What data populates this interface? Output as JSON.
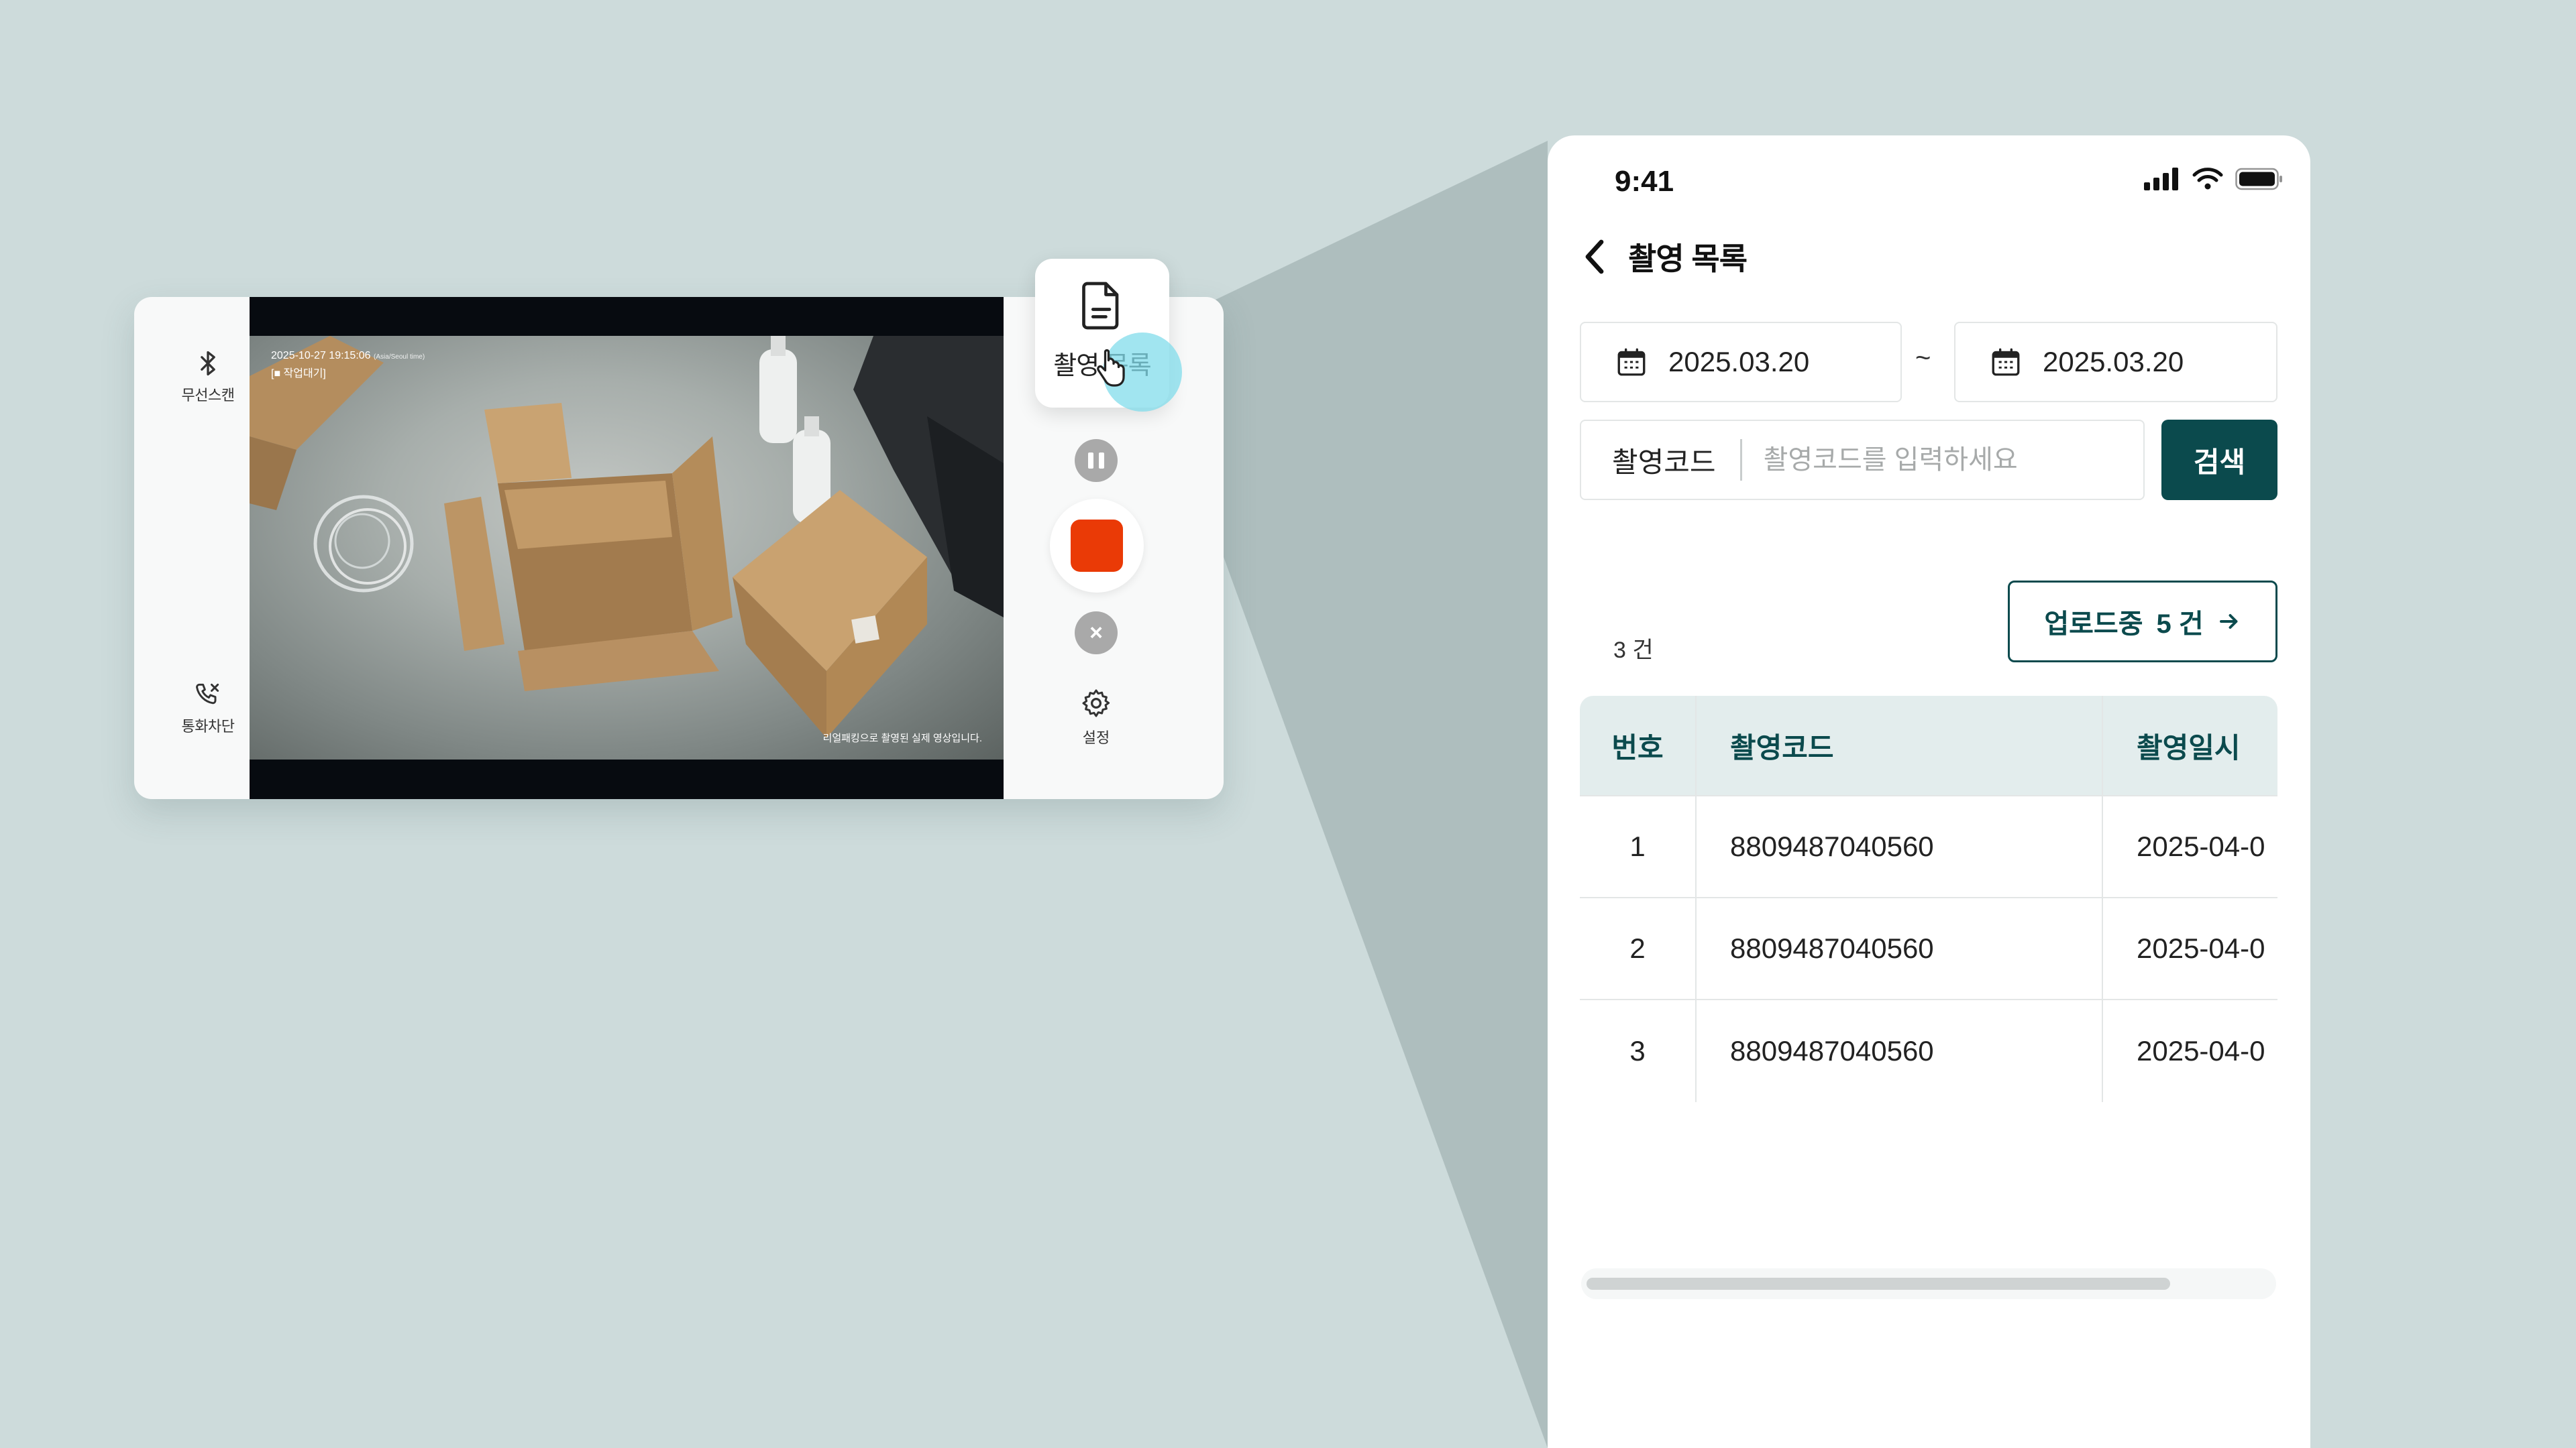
{
  "recorder": {
    "bluetooth_label": "무선스캔",
    "call_block_label": "통화차단",
    "overlay_datetime": "2025-10-27 19:15:06",
    "overlay_timezone": "(Asia/Seoul time)",
    "overlay_status": "[■ 작업대기]",
    "overlay_caption": "리얼패킹으로 촬영된 실제 영상입니다.",
    "list_button_label": "촬영 목록",
    "settings_label": "설정",
    "close_symbol": "×"
  },
  "phone": {
    "status_time": "9:41",
    "nav_title": "촬영 목록",
    "date_from": "2025.03.20",
    "date_separator": "~",
    "date_to": "2025.03.20",
    "code_label": "촬영코드",
    "code_placeholder": "촬영코드를 입력하세요",
    "code_value": "",
    "search_label": "검색",
    "result_count": "3 건",
    "upload_label": "업로드중",
    "upload_count": "5 건",
    "table": {
      "headers": [
        "번호",
        "촬영코드",
        "촬영일시"
      ],
      "rows": [
        [
          "1",
          "8809487040560",
          "2025-04-0"
        ],
        [
          "2",
          "8809487040560",
          "2025-04-0"
        ],
        [
          "3",
          "8809487040560",
          "2025-04-0"
        ]
      ]
    },
    "colors": {
      "primary": "#0b4a4d",
      "header_bg": "#e3eded",
      "stop": "#ea3a06"
    }
  }
}
